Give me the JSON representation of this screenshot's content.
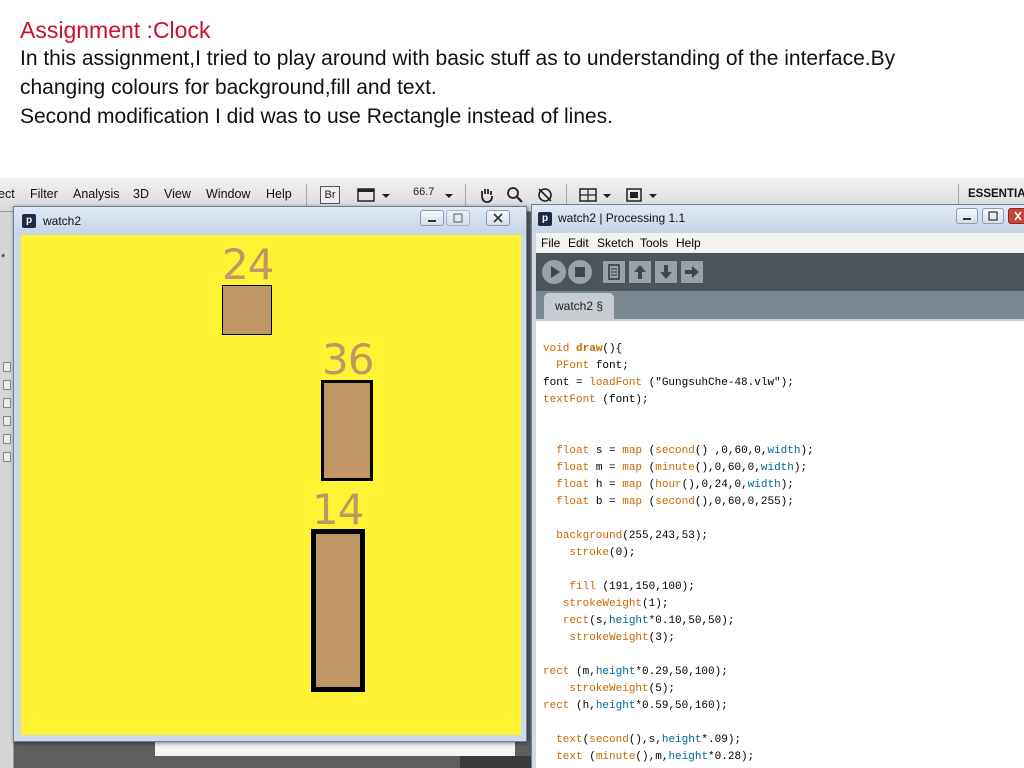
{
  "assignment": {
    "title": "Assignment :Clock",
    "line1": "In this assignment,I tried to play around with basic stuff as to understanding of the interface.By",
    "line2": "changing colours for background,fill and text.",
    "line3": "Second modification I did was to use Rectangle instead of lines."
  },
  "host_app": {
    "menus": [
      "ect",
      "Filter",
      "Analysis",
      "3D",
      "View",
      "Window",
      "Help"
    ],
    "br_label": "Br",
    "zoom": "66.7",
    "workspace": "ESSENTIAL",
    "left_char": "*"
  },
  "sketch_window": {
    "title": "watch2",
    "logo": "p",
    "canvas_color": "#fff334",
    "fill_color": "#bf9664",
    "labels": {
      "second": "24",
      "minute": "36",
      "hour": "14"
    }
  },
  "ide_window": {
    "title": "watch2 | Processing 1.1",
    "logo": "p",
    "menus": [
      "File",
      "Edit",
      "Sketch",
      "Tools",
      "Help"
    ],
    "tab": "watch2 §",
    "code": {
      "l01": "void",
      "l01b": "draw",
      "l01c": "(){",
      "l02": "PFont",
      "l02b": " font;",
      "l03a": "font = ",
      "l03b": "loadFont",
      "l03c": " (\"GungsuhChe-48.vlw\");",
      "l04a": "textFont",
      "l04b": " (font);",
      "l05": "float",
      "l05b": " s = ",
      "l05c": "map",
      "l05d": " (",
      "l05e": "second",
      "l05f": "() ,0,60,0,",
      "l05g": "width",
      "l05h": ");",
      "l06": "float",
      "l06b": " m = ",
      "l06c": "map",
      "l06d": " (",
      "l06e": "minute",
      "l06f": "(),0,60,0,",
      "l06g": "width",
      "l06h": ");",
      "l07": "float",
      "l07b": " h = ",
      "l07c": "map",
      "l07d": " (",
      "l07e": "hour",
      "l07f": "(),0,24,0,",
      "l07g": "width",
      "l07h": ");",
      "l08": "float",
      "l08b": " b = ",
      "l08c": "map",
      "l08d": " (",
      "l08e": "second",
      "l08f": "(),0,60,0,255);",
      "l09a": "background",
      "l09b": "(255,243,53);",
      "l10a": "stroke",
      "l10b": "(0);",
      "l11a": "fill",
      "l11b": " (191,150,100);",
      "l12a": "strokeWeight",
      "l12b": "(1);",
      "l13a": "rect",
      "l13b": "(s,",
      "l13c": "height",
      "l13d": "*0.10,50,50);",
      "l14a": "strokeWeight",
      "l14b": "(3);",
      "l15a": "rect",
      "l15b": " (m,",
      "l15c": "height",
      "l15d": "*0.29,50,100);",
      "l16a": "strokeWeight",
      "l16b": "(5);",
      "l17a": "rect",
      "l17b": " (h,",
      "l17c": "height",
      "l17d": "*0.59,50,160);",
      "l18a": "text",
      "l18b": "(",
      "l18c": "second",
      "l18d": "(),s,",
      "l18e": "height",
      "l18f": "*.09);",
      "l19a": "text",
      "l19b": " (",
      "l19c": "minute",
      "l19d": "(),m,",
      "l19e": "height",
      "l19f": "*0.28);"
    }
  }
}
